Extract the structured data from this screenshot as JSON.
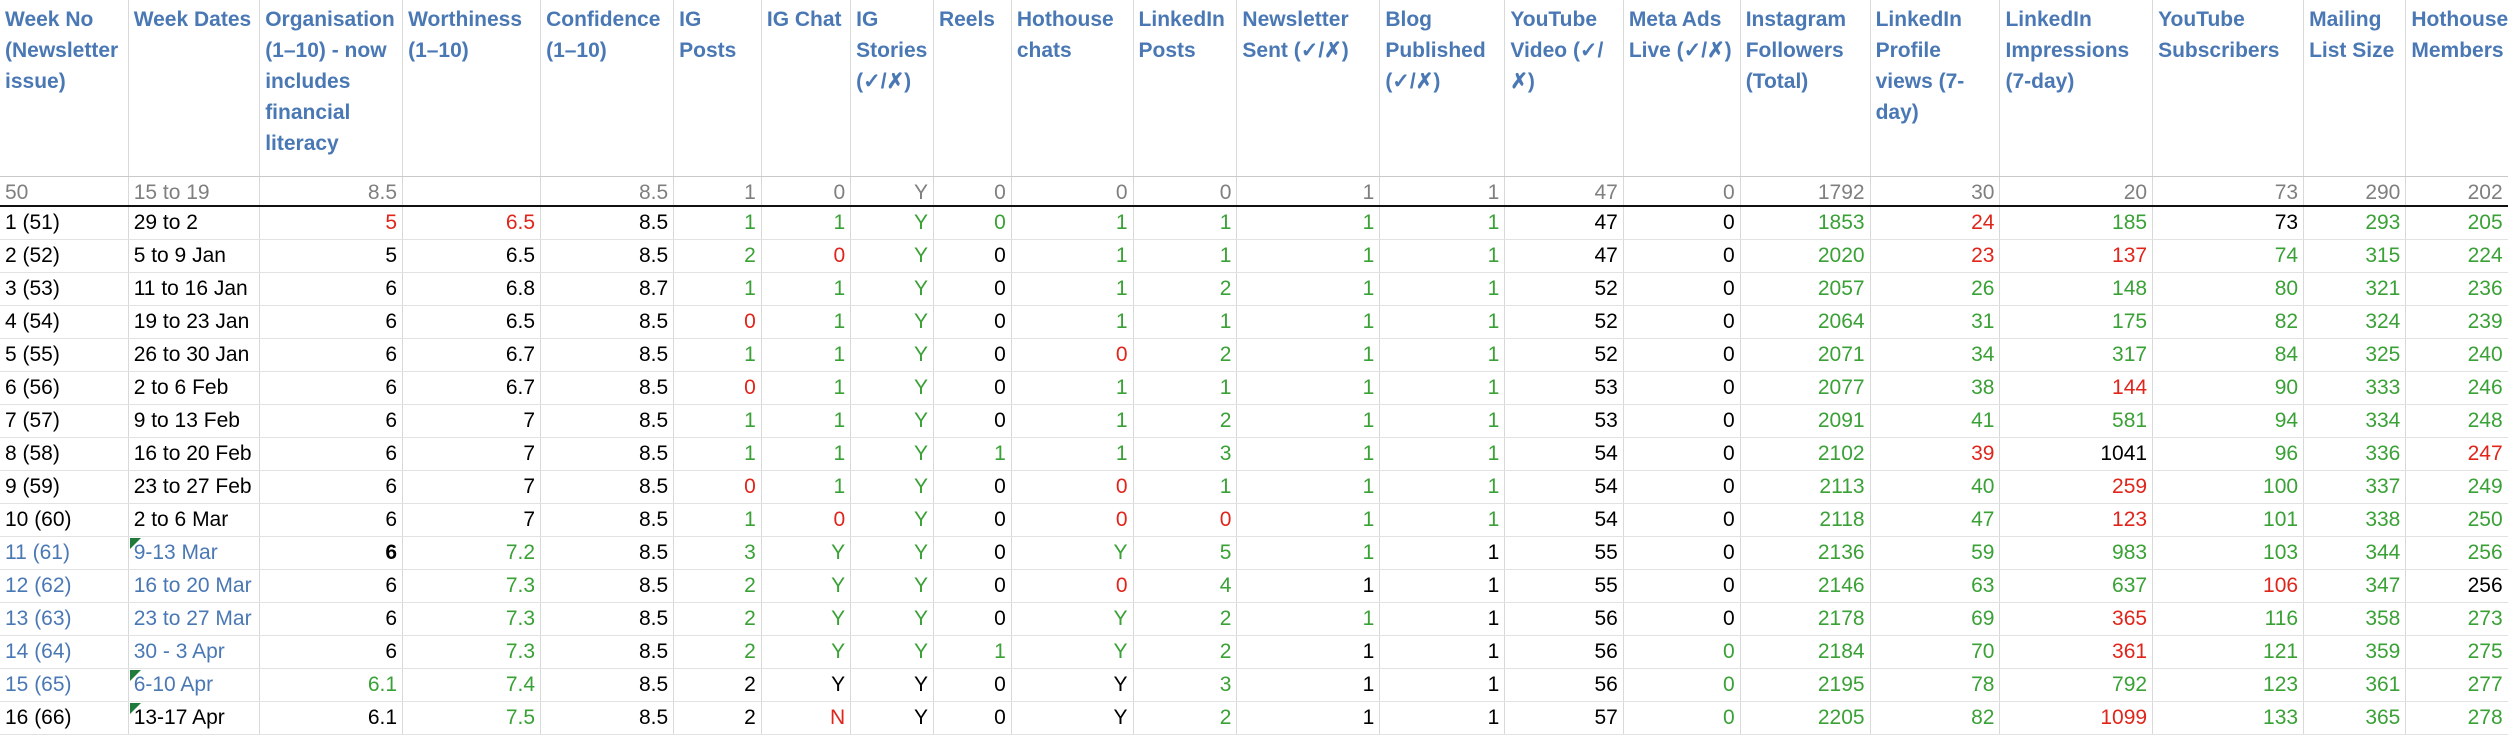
{
  "headers": [
    "Week No (Newsletter issue)",
    "Week Dates",
    "Organisation (1–10) - now includes financial literacy",
    "Worthiness (1–10)",
    "Confidence (1–10)",
    "IG Posts",
    "IG Chat",
    "IG Stories (✓/✗)",
    "Reels",
    "Hothouse chats",
    "LinkedIn Posts",
    "Newsletter Sent (✓/✗)",
    "Blog Published (✓/✗)",
    "YouTube Video (✓/✗)",
    "Meta Ads Live (✓/✗)",
    "Instagram Followers (Total)",
    "LinkedIn Profile views (7-day)",
    "LinkedIn Impressions (7-day)",
    "YouTube Subscribers",
    "Mailing List Size",
    "Hothouse Members"
  ],
  "baseline": [
    "50",
    "15 to 19",
    "8.5",
    "",
    "8.5",
    "1",
    "0",
    "Y",
    "0",
    "0",
    "0",
    "1",
    "1",
    "47",
    "0",
    "1792",
    "30",
    "20",
    "73",
    "290",
    "202"
  ],
  "rows": [
    [
      "1 (51)",
      "29 to 2",
      "5",
      "6.5",
      "8.5",
      "1",
      "1",
      "Y",
      "0",
      "1",
      "1",
      "1",
      "1",
      "47",
      "0",
      "1853",
      "24",
      "185",
      "73",
      "293",
      "205"
    ],
    [
      "2 (52)",
      "5 to 9 Jan",
      "5",
      "6.5",
      "8.5",
      "2",
      "0",
      "Y",
      "0",
      "1",
      "1",
      "1",
      "1",
      "47",
      "0",
      "2020",
      "23",
      "137",
      "74",
      "315",
      "224"
    ],
    [
      "3 (53)",
      "11 to 16 Jan",
      "6",
      "6.8",
      "8.7",
      "1",
      "1",
      "Y",
      "0",
      "1",
      "2",
      "1",
      "1",
      "52",
      "0",
      "2057",
      "26",
      "148",
      "80",
      "321",
      "236"
    ],
    [
      "4 (54)",
      "19 to 23 Jan",
      "6",
      "6.5",
      "8.5",
      "0",
      "1",
      "Y",
      "0",
      "1",
      "1",
      "1",
      "1",
      "52",
      "0",
      "2064",
      "31",
      "175",
      "82",
      "324",
      "239"
    ],
    [
      "5 (55)",
      "26 to 30 Jan",
      "6",
      "6.7",
      "8.5",
      "1",
      "1",
      "Y",
      "0",
      "0",
      "2",
      "1",
      "1",
      "52",
      "0",
      "2071",
      "34",
      "317",
      "84",
      "325",
      "240"
    ],
    [
      "6 (56)",
      "2 to 6 Feb",
      "6",
      "6.7",
      "8.5",
      "0",
      "1",
      "Y",
      "0",
      "1",
      "1",
      "1",
      "1",
      "53",
      "0",
      "2077",
      "38",
      "144",
      "90",
      "333",
      "246"
    ],
    [
      "7 (57)",
      "9 to 13 Feb",
      "6",
      "7",
      "8.5",
      "1",
      "1",
      "Y",
      "0",
      "1",
      "2",
      "1",
      "1",
      "53",
      "0",
      "2091",
      "41",
      "581",
      "94",
      "334",
      "248"
    ],
    [
      "8 (58)",
      "16 to 20 Feb",
      "6",
      "7",
      "8.5",
      "1",
      "1",
      "Y",
      "1",
      "1",
      "3",
      "1",
      "1",
      "54",
      "0",
      "2102",
      "39",
      "1041",
      "96",
      "336",
      "247"
    ],
    [
      "9 (59)",
      "23 to 27 Feb",
      "6",
      "7",
      "8.5",
      "0",
      "1",
      "Y",
      "0",
      "0",
      "1",
      "1",
      "1",
      "54",
      "0",
      "2113",
      "40",
      "259",
      "100",
      "337",
      "249"
    ],
    [
      "10 (60)",
      "2 to 6 Mar",
      "6",
      "7",
      "8.5",
      "1",
      "0",
      "Y",
      "0",
      "0",
      "0",
      "1",
      "1",
      "54",
      "0",
      "2118",
      "47",
      "123",
      "101",
      "338",
      "250"
    ],
    [
      "11 (61)",
      "9-13 Mar",
      "6",
      "7.2",
      "8.5",
      "3",
      "Y",
      "Y",
      "0",
      "Y",
      "5",
      "1",
      "1",
      "55",
      "0",
      "2136",
      "59",
      "983",
      "103",
      "344",
      "256"
    ],
    [
      "12 (62)",
      "16 to 20 Mar",
      "6",
      "7.3",
      "8.5",
      "2",
      "Y",
      "Y",
      "0",
      "0",
      "4",
      "1",
      "1",
      "55",
      "0",
      "2146",
      "63",
      "637",
      "106",
      "347",
      "256"
    ],
    [
      "13 (63)",
      "23 to 27 Mar",
      "6",
      "7.3",
      "8.5",
      "2",
      "Y",
      "Y",
      "0",
      "Y",
      "2",
      "1",
      "1",
      "56",
      "0",
      "2178",
      "69",
      "365",
      "116",
      "358",
      "273"
    ],
    [
      "14 (64)",
      "30 - 3 Apr",
      "6",
      "7.3",
      "8.5",
      "2",
      "Y",
      "Y",
      "1",
      "Y",
      "2",
      "1",
      "1",
      "56",
      "0",
      "2184",
      "70",
      "361",
      "121",
      "359",
      "275"
    ],
    [
      "15 (65)",
      "6-10 Apr",
      "6.1",
      "7.4",
      "8.5",
      "2",
      "Y",
      "Y",
      "0",
      "Y",
      "3",
      "1",
      "1",
      "56",
      "0",
      "2195",
      "78",
      "792",
      "123",
      "361",
      "277"
    ],
    [
      "16 (66)",
      "13-17 Apr",
      "6.1",
      "7.5",
      "8.5",
      "2",
      "N",
      "Y",
      "0",
      "Y",
      "2",
      "1",
      "1",
      "57",
      "0",
      "2205",
      "82",
      "1099",
      "133",
      "365",
      "278"
    ]
  ],
  "colors": {
    "header_blue": "#4a78b4",
    "green": "#3aa136",
    "red": "#e0251b",
    "gray": "#7f7f7f",
    "black": "#000000",
    "comment_flag": "#1f7a3b"
  },
  "cell_colors": [
    "kkrrkggggggggkkgrgkgg",
    "kkkkkgrgkggggkkgrrggg",
    "kkkkkgggkggggggggggggg",
    "kkkkkrggkggggggggggggg",
    "kkkkkgggkrgggggggggggg",
    "kkkkkrggkggggggggrrggg",
    "kkkkkgggkgggggkggggggg",
    "kkkkkggggggggggrkgggrr",
    "kkkkkrggkrgggggggrgggg",
    "kkkkkgrgkrrggkggrgggg",
    "bbkgkgggkgggkkgggggggg",
    "bbkgkgggkrgkkgggrggk",
    "bbkgkgggkgggkkgggrggg",
    "bbkgkggggggkkgggrggg",
    "bbggkkkkkkgkkgggggg",
    "kkkgkkrkkkgkkgggggg"
  ]
}
